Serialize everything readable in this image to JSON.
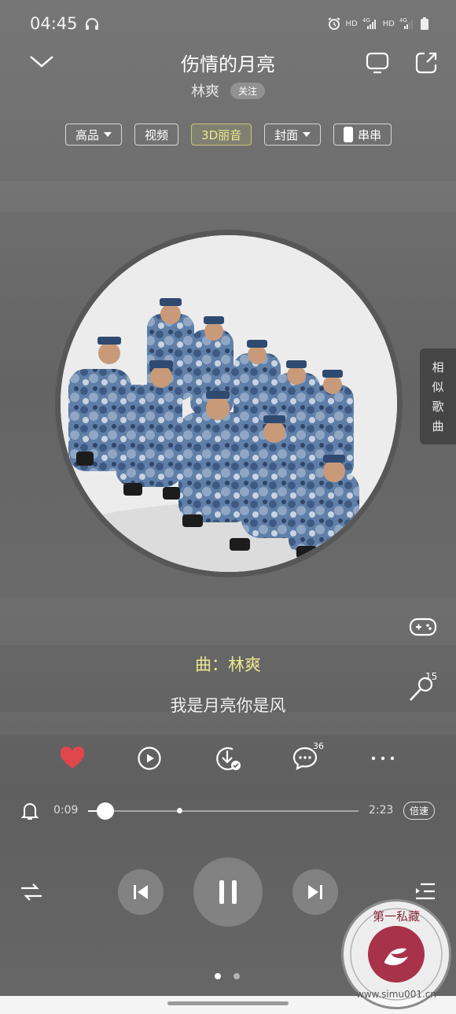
{
  "status": {
    "time": "04:45",
    "net1": "HD",
    "net2": "HD",
    "sig": "4G"
  },
  "song": {
    "title": "伤情的月亮",
    "artist": "林爽",
    "follow": "关注"
  },
  "chips": {
    "quality": "高品",
    "video": "视频",
    "audio3d": "3D丽音",
    "cover": "封面",
    "chuanchuan": "串串"
  },
  "side_tab": [
    "相",
    "似",
    "歌",
    "曲"
  ],
  "karaoke_count": "15",
  "lyrics": {
    "credit": "曲：林爽",
    "line": "我是月亮你是风"
  },
  "actions": {
    "comment_count": "36"
  },
  "progress": {
    "current": "0:09",
    "total": "2:23",
    "played_fraction": 0.063,
    "buffered_fraction": 0.337,
    "speed": "倍速"
  },
  "pager": {
    "pages": 2,
    "current": 1
  },
  "watermark": "第一私藏 www.simu001.cn",
  "colors": {
    "accent_lyric": "#ece98f",
    "like": "#e0464c",
    "bg": "#6a6a6a"
  }
}
